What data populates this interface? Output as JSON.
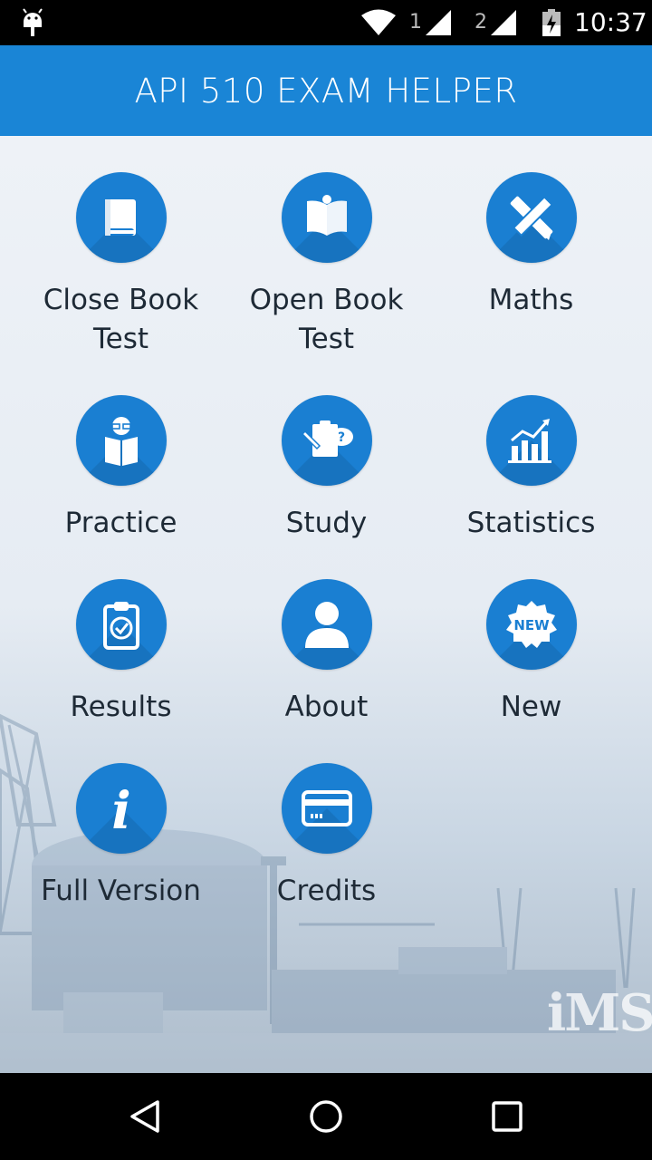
{
  "status_bar": {
    "sim1": "1",
    "sim2": "2",
    "time": "10:37"
  },
  "app_bar": {
    "title": "API 510 EXAM HELPER",
    "color": "#1a85d6"
  },
  "menu": {
    "items": [
      {
        "label": "Close Book Test",
        "icon": "book-icon"
      },
      {
        "label": "Open Book Test",
        "icon": "open-book-icon"
      },
      {
        "label": "Maths",
        "icon": "ruler-pencil-icon"
      },
      {
        "label": "Practice",
        "icon": "reader-icon"
      },
      {
        "label": "Study",
        "icon": "clipboard-question-icon"
      },
      {
        "label": "Statistics",
        "icon": "bar-chart-icon"
      },
      {
        "label": "Results",
        "icon": "clipboard-check-icon"
      },
      {
        "label": "About",
        "icon": "person-icon"
      },
      {
        "label": "New",
        "icon": "new-badge-icon",
        "badge_text": "NEW"
      },
      {
        "label": "Full Version",
        "icon": "info-icon",
        "glyph": "i"
      },
      {
        "label": "Credits",
        "icon": "credit-card-icon"
      }
    ],
    "accent_color": "#1a7fd2"
  },
  "watermark": {
    "logo_text": "iMS"
  },
  "nav_bar": {
    "back": "back-icon",
    "home": "home-icon",
    "recents": "recents-icon"
  }
}
